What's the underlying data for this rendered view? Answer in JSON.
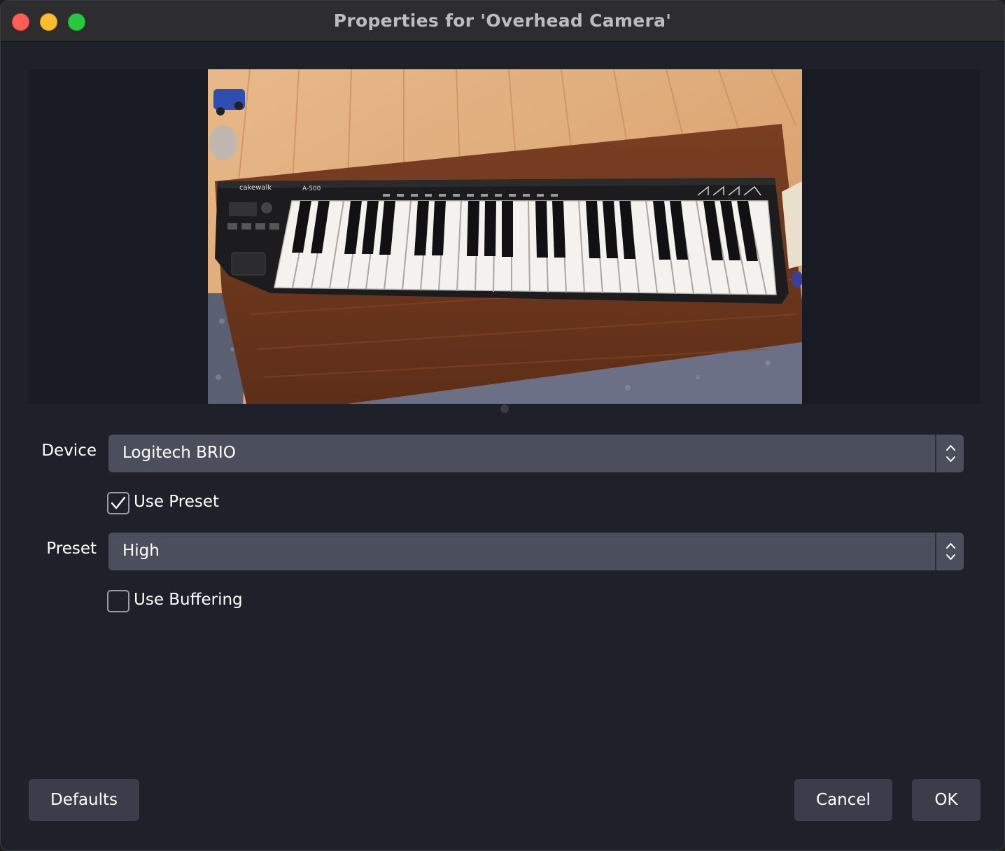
{
  "window": {
    "title": "Properties for 'Overhead Camera'"
  },
  "form": {
    "device_label": "Device",
    "device_value": "Logitech BRIO",
    "use_preset_label": "Use Preset",
    "use_preset_checked": true,
    "preset_label": "Preset",
    "preset_value": "High",
    "use_buffering_label": "Use Buffering",
    "use_buffering_checked": false
  },
  "buttons": {
    "defaults": "Defaults",
    "cancel": "Cancel",
    "ok": "OK"
  },
  "preview_logo_text": "cakewalk",
  "preview_model_text": "A-500",
  "colors": {
    "window_bg": "#1f212a",
    "titlebar_bg": "#2d2d2f",
    "combo_bg": "#4b4f5c",
    "button_bg": "#3b3e4a",
    "close": "#fe5f57",
    "minimize": "#febc2e",
    "zoom": "#28c840"
  }
}
